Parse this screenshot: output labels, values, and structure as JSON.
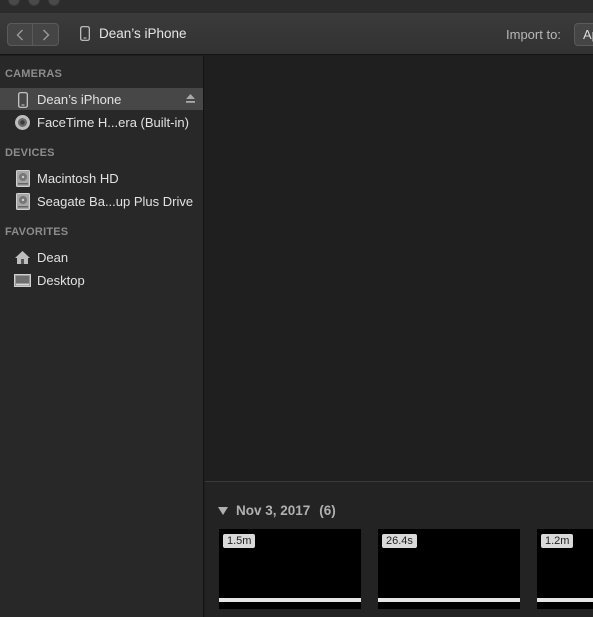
{
  "toolbar": {
    "device_name": "Dean’s iPhone",
    "import_label": "Import to:",
    "import_value": "Applications"
  },
  "sidebar": {
    "sections": [
      {
        "header": "CAMERAS",
        "items": [
          {
            "label": "Dean’s iPhone",
            "icon": "iphone-icon",
            "selected": true,
            "eject": true
          },
          {
            "label": "FaceTime H...era (Built-in)",
            "icon": "camera-icon"
          }
        ]
      },
      {
        "header": "DEVICES",
        "items": [
          {
            "label": "Macintosh HD",
            "icon": "hard-drive-icon"
          },
          {
            "label": "Seagate Ba...up Plus Drive",
            "icon": "hard-drive-icon"
          }
        ]
      },
      {
        "header": "FAVORITES",
        "items": [
          {
            "label": "Dean",
            "icon": "home-icon"
          },
          {
            "label": "Desktop",
            "icon": "desktop-icon"
          }
        ]
      }
    ]
  },
  "media": {
    "date": "Nov 3, 2017",
    "count": "(6)",
    "thumbnails": [
      {
        "duration": "1.5m"
      },
      {
        "duration": "26.4s"
      },
      {
        "duration": "1.2m"
      }
    ]
  }
}
